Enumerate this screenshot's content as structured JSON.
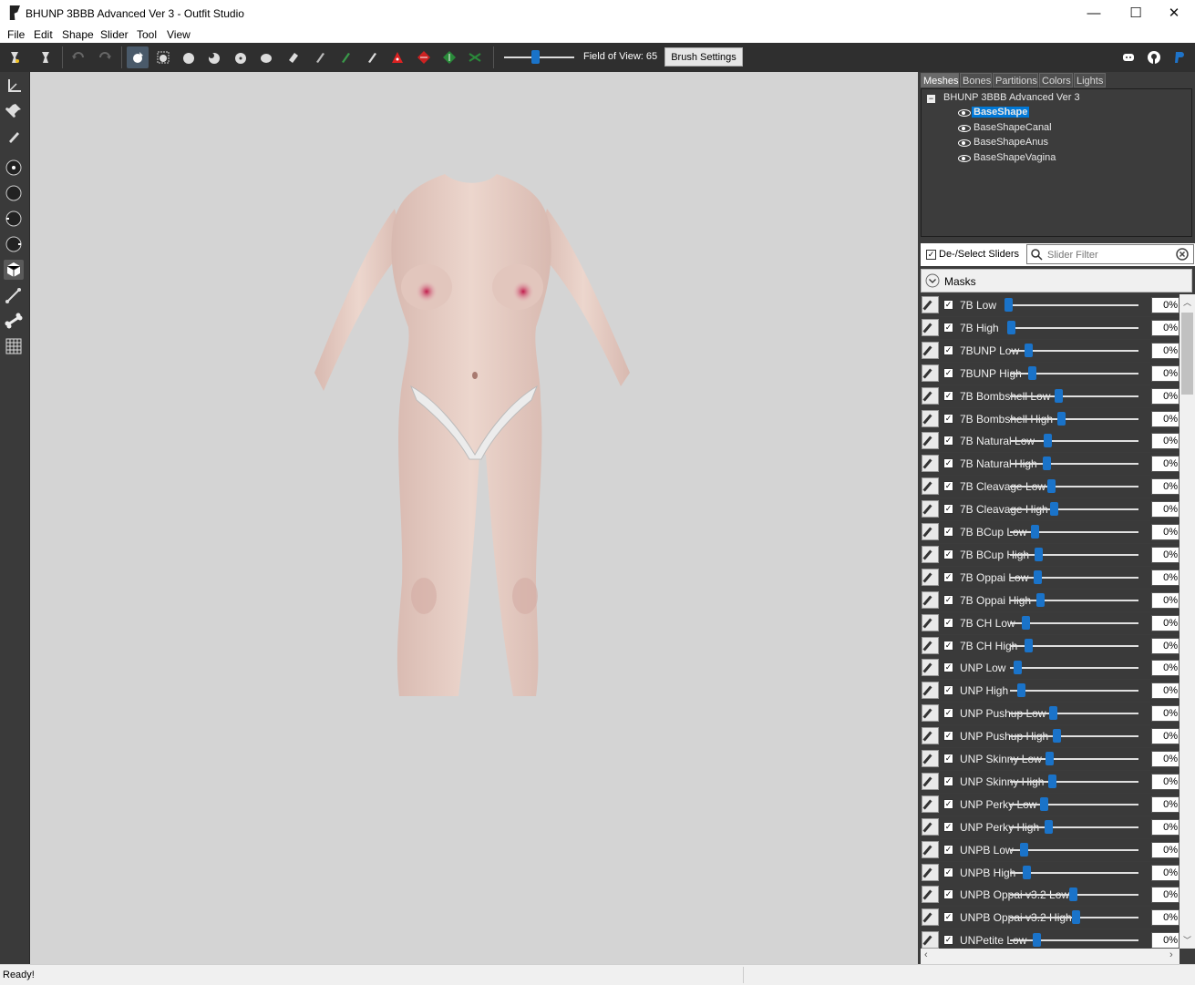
{
  "window": {
    "title": "BHUNP 3BBB Advanced Ver 3 - Outfit Studio",
    "minimize": "—",
    "maximize": "☐",
    "close": "✕"
  },
  "menu": [
    "File",
    "Edit",
    "Shape",
    "Slider",
    "Tool",
    "View"
  ],
  "toolbar": {
    "fov_label": "Field of View: 65",
    "fov_value": 65,
    "brush_settings": "Brush Settings",
    "icons": [
      "outfit-studio-icon",
      "project-icon",
      "undo-icon",
      "redo-icon",
      "select-icon",
      "transform-icon",
      "inflate-brush-icon",
      "deflate-brush-icon",
      "move-brush-icon",
      "smooth-brush-icon",
      "undiff-brush-icon",
      "mask-brush-icon",
      "color-brush-icon",
      "alpha-brush-icon",
      "weight-brush-icon",
      "collapse-vertex-icon",
      "flip-edge-icon",
      "split-edge-icon",
      "discord-icon",
      "github-icon",
      "paypal-icon"
    ]
  },
  "right_panel": {
    "tabs": [
      "Meshes",
      "Bones",
      "Partitions",
      "Colors",
      "Lights"
    ],
    "tree": {
      "root": "BHUNP 3BBB Advanced Ver 3",
      "shapes": [
        "BaseShape",
        "BaseShapeCanal",
        "BaseShapeAnus",
        "BaseShapeVagina"
      ],
      "selected": "BaseShape"
    },
    "deselect_label": "De-/Select Sliders",
    "filter_placeholder": "Slider Filter",
    "masks_label": "Masks",
    "sliders": [
      {
        "name": "7B Low",
        "value": "0%"
      },
      {
        "name": "7B High",
        "value": "0%"
      },
      {
        "name": "7BUNP Low",
        "value": "0%"
      },
      {
        "name": "7BUNP High",
        "value": "0%"
      },
      {
        "name": "7B Bombshell Low",
        "value": "0%"
      },
      {
        "name": "7B Bombshell High",
        "value": "0%"
      },
      {
        "name": "7B Natural Low",
        "value": "0%"
      },
      {
        "name": "7B Natural High",
        "value": "0%"
      },
      {
        "name": "7B Cleavage Low",
        "value": "0%"
      },
      {
        "name": "7B Cleavage High",
        "value": "0%"
      },
      {
        "name": "7B BCup Low",
        "value": "0%"
      },
      {
        "name": "7B BCup High",
        "value": "0%"
      },
      {
        "name": "7B Oppai Low",
        "value": "0%"
      },
      {
        "name": "7B Oppai High",
        "value": "0%"
      },
      {
        "name": "7B CH Low",
        "value": "0%"
      },
      {
        "name": "7B CH High",
        "value": "0%"
      },
      {
        "name": "UNP Low",
        "value": "0%"
      },
      {
        "name": "UNP High",
        "value": "0%"
      },
      {
        "name": "UNP Pushup Low",
        "value": "0%"
      },
      {
        "name": "UNP Pushup High",
        "value": "0%"
      },
      {
        "name": "UNP Skinny Low",
        "value": "0%"
      },
      {
        "name": "UNP Skinny High",
        "value": "0%"
      },
      {
        "name": "UNP Perky Low",
        "value": "0%"
      },
      {
        "name": "UNP Perky High",
        "value": "0%"
      },
      {
        "name": "UNPB Low",
        "value": "0%"
      },
      {
        "name": "UNPB High",
        "value": "0%"
      },
      {
        "name": "UNPB Oppai v3.2 Low",
        "value": "0%"
      },
      {
        "name": "UNPB Oppai v3.2 High",
        "value": "0%"
      },
      {
        "name": "UNPetite Low",
        "value": "0%"
      }
    ]
  },
  "status": "Ready!",
  "colors": {
    "accent": "#1a73c9",
    "selection": "#0078d7",
    "viewport_bg": "#d4d4d4",
    "panel_bg": "#3c3c3c"
  }
}
